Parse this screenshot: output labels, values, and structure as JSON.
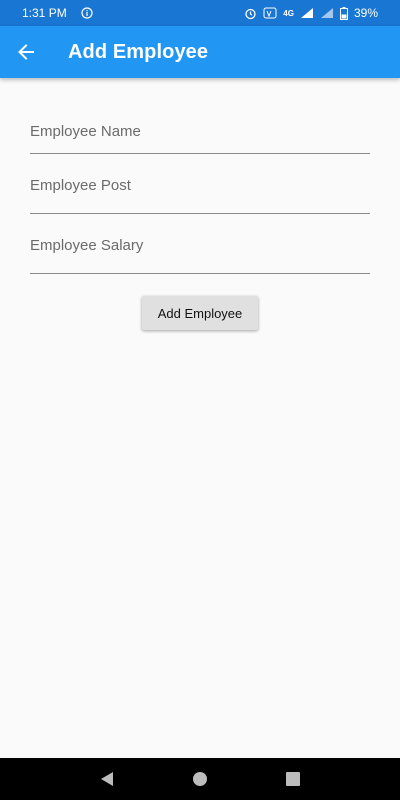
{
  "status_bar": {
    "time": "1:31 PM",
    "network": "4G",
    "battery": "39%",
    "icons": [
      "info-icon",
      "alarm-icon",
      "volte-icon",
      "signal-icon",
      "battery-icon"
    ]
  },
  "app_bar": {
    "title": "Add Employee",
    "back_icon": "arrow-back-icon"
  },
  "form": {
    "fields": [
      {
        "label": "Employee Name",
        "value": ""
      },
      {
        "label": "Employee Post",
        "value": ""
      },
      {
        "label": "Employee Salary",
        "value": ""
      }
    ],
    "submit_label": "Add Employee"
  },
  "nav_bar": {
    "icons": [
      "nav-back-icon",
      "nav-home-icon",
      "nav-recents-icon"
    ]
  },
  "colors": {
    "status_bar": "#1976d2",
    "app_bar": "#2196f3",
    "background": "#fafafa",
    "button": "#e0e0e0"
  }
}
